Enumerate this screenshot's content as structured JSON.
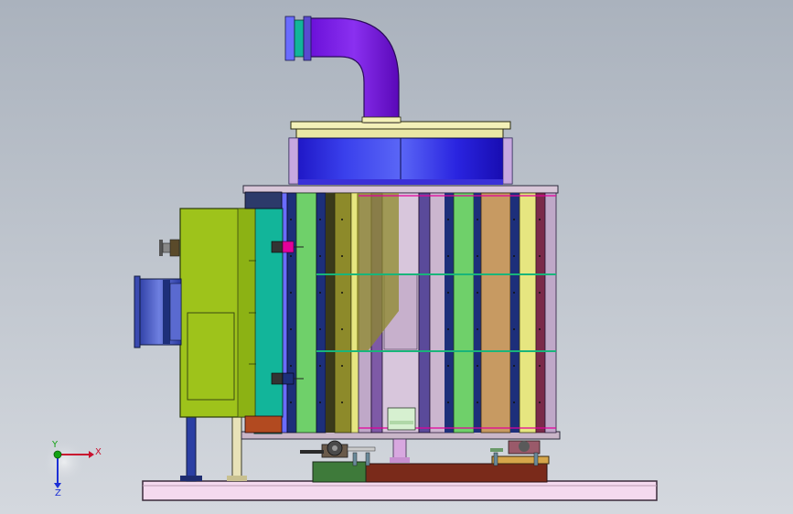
{
  "viewport": {
    "background_top": "#aab2bd",
    "background_bottom": "#d2d6dc"
  },
  "model": {
    "colors": {
      "duct": "#7a1ee6",
      "duct_dark": "#5a10b0",
      "blue_drum": "#1f18d8",
      "blue_drum_light": "#4a54f2",
      "lid": "#f3f0b8",
      "green_box": "#9ec31b",
      "green_box_dark": "#7a9a10",
      "teal_panel": "#12b59a",
      "olive_panel": "#8d8a2a",
      "tan_panel": "#c79a62",
      "light_green": "#6fd06a",
      "yellow_panel": "#e6e680",
      "support_blue": "#2b3fa3",
      "base_plate": "#f4d9ee",
      "base_rust": "#7a2a1a",
      "frame_line": "#1a1a2e",
      "magenta_bracket": "#e3009a"
    },
    "icons": [
      "elbow-duct-icon",
      "cylindrical-drum-icon",
      "inlet-fan-icon",
      "valve-handle-icon"
    ]
  },
  "triad": {
    "x_label": "X",
    "y_label": "Y",
    "z_label": "Z",
    "x_color": "#c8102e",
    "y_color": "#13a113",
    "z_color": "#1b2fd6"
  }
}
